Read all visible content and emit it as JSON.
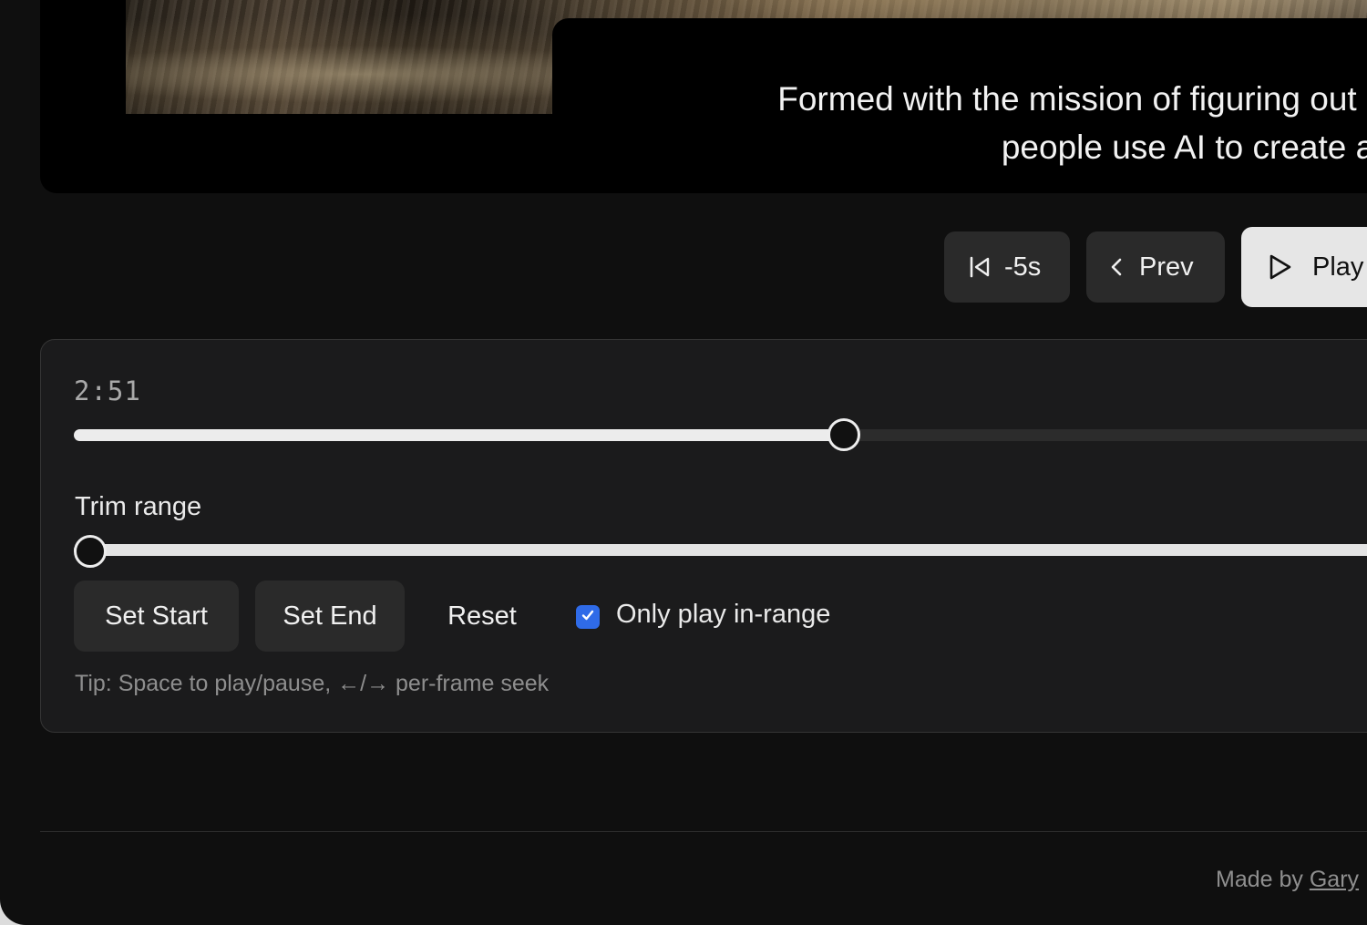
{
  "video": {
    "caption_line1": "Formed with the mission of figuring out how to",
    "caption_line2": "people use AI to create all so"
  },
  "transport": {
    "back5_label": "-5s",
    "prev_label": "Prev",
    "play_label": "Play"
  },
  "player": {
    "timecode": "2:51",
    "seek_progress": 0.586,
    "trim_label": "Trim range",
    "trim_start": 0.0,
    "set_start_label": "Set Start",
    "set_end_label": "Set End",
    "reset_label": "Reset",
    "only_in_range_label": "Only play in-range",
    "only_in_range_checked": true,
    "tip": "Tip: Space to play/pause, ←/→ per-frame seek"
  },
  "footer": {
    "made_by_prefix": "Made by ",
    "author_link": "Gary"
  },
  "colors": {
    "app_bg": "#0f0f0f",
    "card_bg": "#1b1b1c",
    "button_bg": "#2a2a2a",
    "play_button_bg": "#e6e6e6",
    "checkbox_accent": "#2f6be8",
    "slider_fill": "#ececec"
  },
  "icons": {
    "back5": "skip-back-icon",
    "prev": "chevron-left-icon",
    "play": "play-icon",
    "checkbox": "checkmark-icon"
  }
}
